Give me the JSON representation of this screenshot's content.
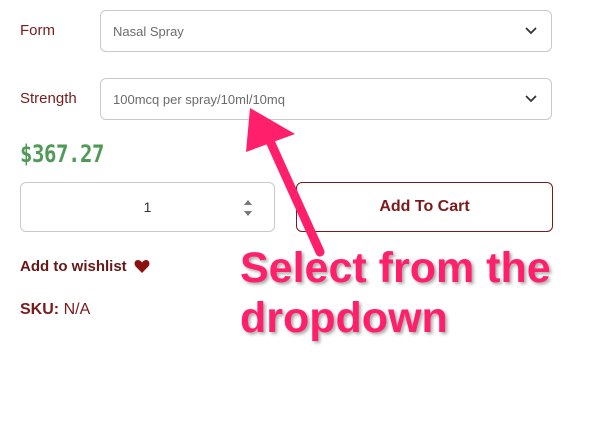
{
  "form": {
    "label": "Form",
    "value": "Nasal Spray"
  },
  "strength": {
    "label": "Strength",
    "value": "100mcq per spray/10ml/10mq"
  },
  "price": "$367.27",
  "quantity": {
    "value": "1"
  },
  "add_to_cart_label": "Add To Cart",
  "wishlist_label": "Add to wishlist",
  "sku": {
    "label": "SKU:",
    "value": "N/A"
  },
  "annotation": {
    "line1": "Select from the",
    "line2": "dropdown"
  },
  "colors": {
    "accent": "#7a1a1a",
    "price": "#4f9a57",
    "annotation": "#ff1f6b"
  },
  "icons": {
    "dropdown": "chevron-down-icon",
    "stepper": "up-down-arrows-icon",
    "wishlist": "heart-icon"
  }
}
